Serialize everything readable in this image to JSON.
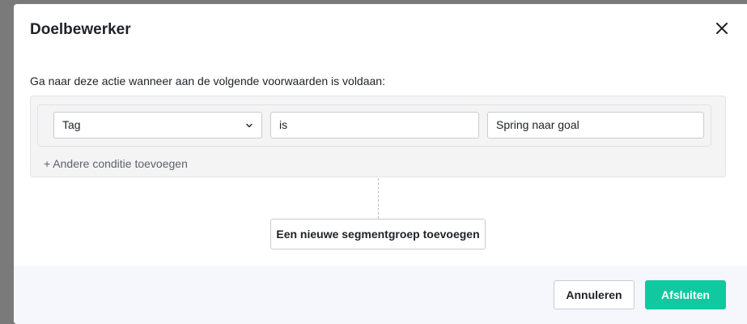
{
  "modal": {
    "title": "Doelbewerker",
    "close_icon": "close-icon"
  },
  "intro_text": "Ga naar deze actie wanneer aan de volgende voorwaarden is voldaan:",
  "condition": {
    "field_selected": "Tag",
    "operator_value": "is",
    "value": "Spring naar goal"
  },
  "add_condition_label": "+ Andere conditie toevoegen",
  "new_group_label": "Een nieuwe segmentgroep toevoegen",
  "footer": {
    "cancel_label": "Annuleren",
    "finish_label": "Afsluiten"
  },
  "colors": {
    "accent": "#10c9a0",
    "footer_bg": "#f5f7fd",
    "overlay": "#7a7a7a"
  }
}
